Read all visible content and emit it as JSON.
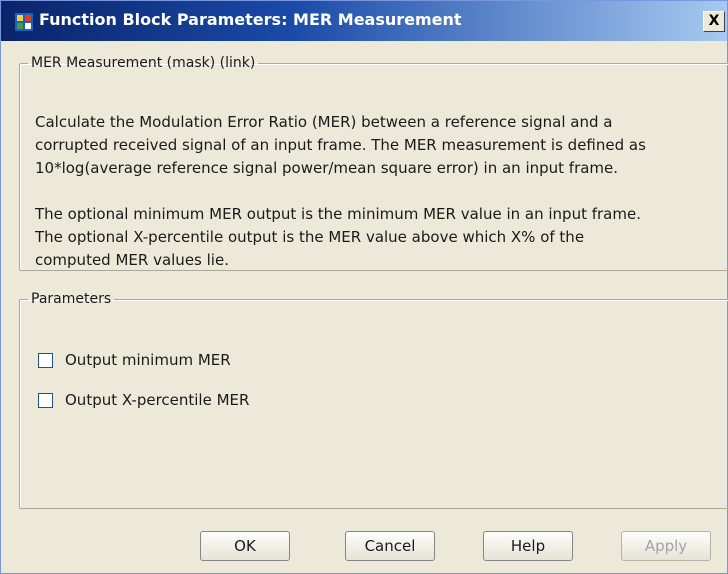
{
  "window": {
    "title": "Function Block Parameters: MER Measurement",
    "close_label": "X"
  },
  "description_group": {
    "legend": "MER Measurement (mask) (link)",
    "text": "Calculate the Modulation Error Ratio (MER) between a reference signal and a\ncorrupted received signal of an input frame. The MER measurement is defined as\n10*log(average reference signal power/mean square error) in an input frame.\n\nThe optional minimum MER output is the minimum MER value in an input frame.\nThe optional X-percentile output is the MER value above which X% of the\ncomputed MER values lie."
  },
  "parameters_group": {
    "legend": "Parameters",
    "checkboxes": [
      {
        "label": "Output minimum MER",
        "checked": false
      },
      {
        "label": "Output X-percentile MER",
        "checked": false
      }
    ]
  },
  "buttons": {
    "ok": "OK",
    "cancel": "Cancel",
    "help": "Help",
    "apply": "Apply"
  }
}
